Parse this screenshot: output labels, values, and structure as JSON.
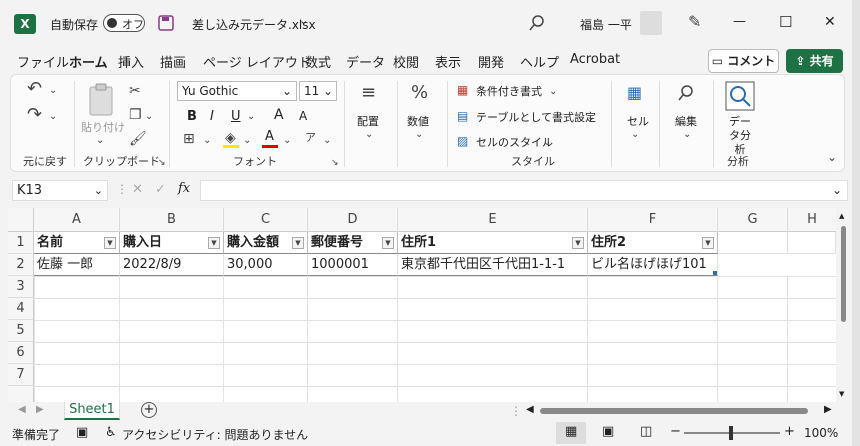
{
  "titlebar": {
    "autosave_label": "自動保存",
    "toggle_label": "オフ",
    "filename": "差し込み元データ.xlsx",
    "user_name": "福島 一平",
    "min_glyph": "—",
    "max_glyph": "☐",
    "close_glyph": "✕"
  },
  "tabs": [
    "ファイル",
    "ホーム",
    "挿入",
    "描画",
    "ページ レイアウト",
    "数式",
    "データ",
    "校閲",
    "表示",
    "開発",
    "ヘルプ",
    "Acrobat"
  ],
  "buttons": {
    "comment": "コメント",
    "share": "共有"
  },
  "ribbon": {
    "undo_group": "元に戻す",
    "clipboard_group": "クリップボード",
    "paste_label": "貼り付け",
    "font_group": "フォント",
    "font_name": "Yu Gothic",
    "font_size": "11",
    "bold": "B",
    "italic": "I",
    "underline": "U",
    "grow_font": "A",
    "shrink_font": "A",
    "alignment": "配置",
    "number": "数値",
    "conditional_format": "条件付き書式",
    "format_as_table": "テーブルとして書式設定",
    "cell_styles": "セルのスタイル",
    "styles_group": "スタイル",
    "cells": "セル",
    "editing": "編集",
    "data_analysis": "データ分析",
    "analysis_group": "分析"
  },
  "formula_bar": {
    "name_box": "K13",
    "fx": "fx",
    "value": ""
  },
  "grid": {
    "columns": [
      "A",
      "B",
      "C",
      "D",
      "E",
      "F",
      "G",
      "H"
    ],
    "rows": [
      "1",
      "2",
      "3",
      "4",
      "5",
      "6",
      "7"
    ],
    "header_row": [
      "名前",
      "購入日",
      "購入金額",
      "郵便番号",
      "住所1",
      "住所2"
    ],
    "data_rows": [
      [
        "佐藤 一郎",
        "2022/8/9",
        "30,000",
        "1000001",
        "東京都千代田区千代田1-1-1",
        "ビル名ほげほげ101"
      ]
    ]
  },
  "sheet_tab": "Sheet1",
  "status": {
    "ready": "準備完了",
    "accessibility": "アクセシビリティ: 問題ありません",
    "zoom": "100%"
  },
  "colors": {
    "accent": "#1e7145"
  }
}
